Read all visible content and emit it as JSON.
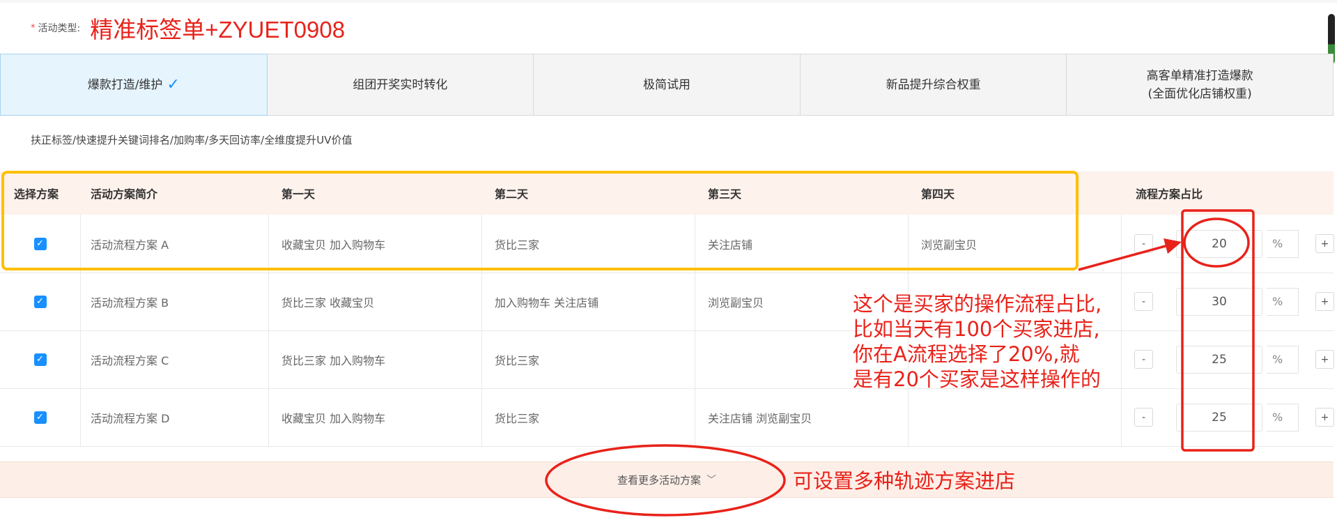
{
  "activity_type": {
    "label": "活动类型:",
    "required_mark": "*",
    "value": "精准标签单+ZYUET0908"
  },
  "tabs": [
    {
      "label": "爆款打造/维护",
      "active": true,
      "icon": "check-icon"
    },
    {
      "label": "组团开奖实时转化"
    },
    {
      "label": "极简试用"
    },
    {
      "label": "新品提升综合权重"
    },
    {
      "label": "高客单精准打造爆款",
      "sublabel": "(全面优化店铺权重)"
    }
  ],
  "description": "扶正标签/快速提升关键词排名/加购率/多天回访率/全维度提升UV价值",
  "table": {
    "headers": [
      "选择方案",
      "活动方案简介",
      "第一天",
      "第二天",
      "第三天",
      "第四天",
      "流程方案占比"
    ],
    "rows": [
      {
        "checked": true,
        "name": "活动流程方案 A",
        "day1": "收藏宝贝 加入购物车",
        "day2": "货比三家",
        "day3": "关注店铺",
        "day4": "浏览副宝贝",
        "ratio": "20"
      },
      {
        "checked": true,
        "name": "活动流程方案 B",
        "day1": "货比三家 收藏宝贝",
        "day2": "加入购物车 关注店铺",
        "day3": "浏览副宝贝",
        "day4": "",
        "ratio": "30"
      },
      {
        "checked": true,
        "name": "活动流程方案 C",
        "day1": "货比三家 加入购物车",
        "day2": "货比三家",
        "day3": "",
        "day4": "",
        "ratio": "25"
      },
      {
        "checked": true,
        "name": "活动流程方案 D",
        "day1": "收藏宝贝 加入购物车",
        "day2": "货比三家",
        "day3": "关注店铺 浏览副宝贝",
        "day4": "",
        "ratio": "25"
      }
    ],
    "minus": "-",
    "plus": "+",
    "percent": "%"
  },
  "more_button": {
    "label": "查看更多活动方案",
    "icon": "chevron-down-icon"
  },
  "annotations": {
    "ratio_note": [
      "这个是买家的操作流程占比,",
      "比如当天有100个买家进店,",
      "你在A流程选择了20%,就",
      "是有20个买家是这样操作的"
    ],
    "more_note": "可设置多种轨迹方案进店"
  },
  "colors": {
    "annotation": "#e8221a",
    "highlight_box": "#ffbf00",
    "accent": "#1890ff"
  }
}
